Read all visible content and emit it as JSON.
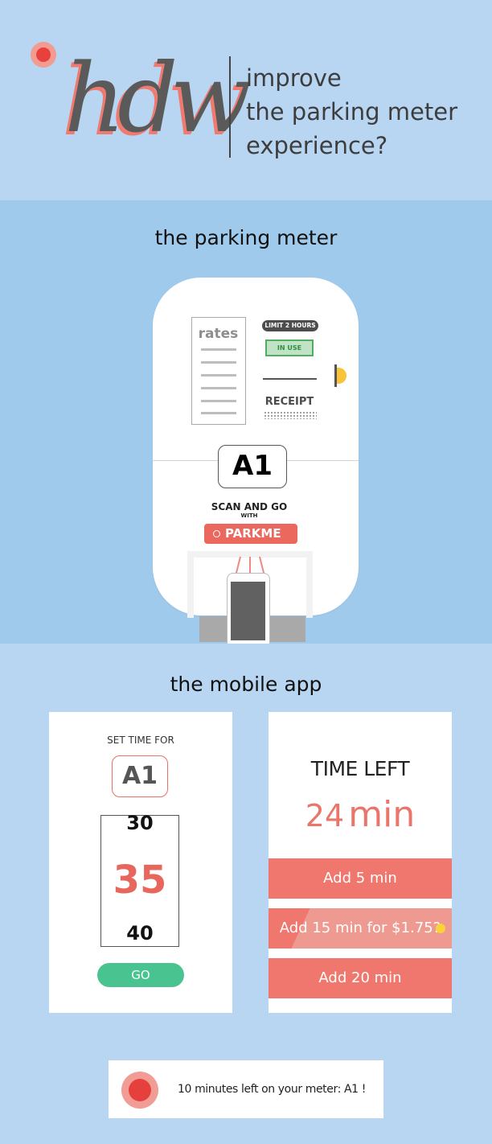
{
  "header": {
    "logo_text": "hdw",
    "title": "improve\nthe parking meter\nexperience?"
  },
  "meter_section": {
    "title": "the parking meter",
    "rates_label": "rates",
    "limit_badge": "LIMIT 2 HOURS",
    "status_badge": "IN USE",
    "receipt_label": "RECEIPT",
    "space_id": "A1",
    "scan_label": "SCAN AND GO",
    "with_label": "WITH",
    "brand_label": "PARKME"
  },
  "app_section": {
    "title": "the mobile app",
    "set_time_label": "SET TIME FOR",
    "space_id": "A1",
    "picker": {
      "prev": "30",
      "selected": "35",
      "next": "40"
    },
    "go_label": "GO",
    "time_left_label": "TIME LEFT",
    "time_left_value": "24",
    "time_left_unit": "min",
    "add_5_label": "Add 5 min",
    "add_15_label": "Add 15 min for $1.75?",
    "add_20_label": "Add 20 min",
    "notification": "10 minutes left on your meter: A1 !"
  },
  "colors": {
    "accent": "#e9756b",
    "go_green": "#49c490",
    "in_use_green": "#52ad62",
    "coin_yellow": "#f9c33a",
    "sky_light": "#b8d6f2",
    "sky_mid": "#9fcaec"
  }
}
